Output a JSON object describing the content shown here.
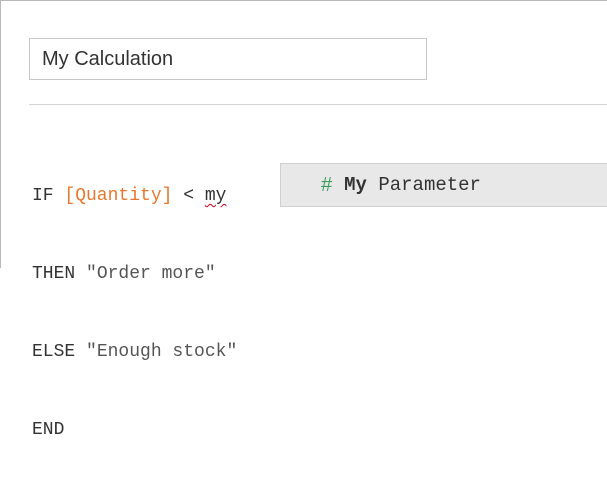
{
  "calculation": {
    "name_value": "My Calculation"
  },
  "editor": {
    "lines": [
      {
        "keyword": "IF ",
        "field": "[Quantity]",
        "operator": " < ",
        "typed": "my"
      },
      {
        "keyword": "THEN ",
        "string": "\"Order more\""
      },
      {
        "keyword": "ELSE ",
        "string": "\"Enough stock\""
      },
      {
        "keyword": "END"
      }
    ]
  },
  "autocomplete": {
    "icon": "#",
    "icon_name": "number-parameter-icon",
    "match": "My",
    "rest": " Parameter"
  },
  "colors": {
    "field": "#e8772e",
    "param_icon": "#3c9e62",
    "squiggle": "#d0021b",
    "autocomplete_bg": "#e8e8e8"
  }
}
